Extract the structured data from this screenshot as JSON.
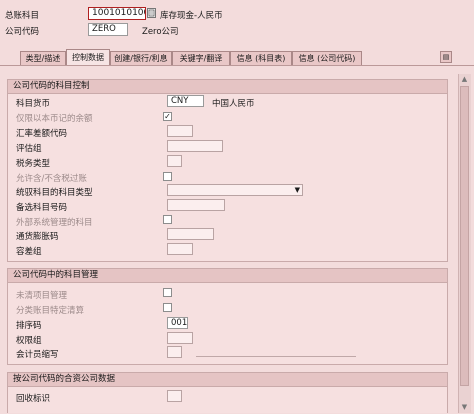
{
  "header": {
    "gl_account_label": "总账科目",
    "gl_account_value": "1001010100",
    "gl_account_desc": "库存现金-人民币",
    "company_code_label": "公司代码",
    "company_code_value": "ZERO",
    "company_code_desc": "Zero公司"
  },
  "tabs": [
    {
      "label": "类型/描述"
    },
    {
      "label": "控制数据"
    },
    {
      "label": "创建/银行/利息"
    },
    {
      "label": "关键字/翻译"
    },
    {
      "label": "信息 (科目表)"
    },
    {
      "label": "信息 (公司代码)"
    }
  ],
  "group1": {
    "title": "公司代码的科目控制",
    "currency_label": "科目货币",
    "currency_value": "CNY",
    "currency_desc": "中国人民币",
    "local_balances_label": "仅限以本币记的余额",
    "local_balances_checked": "✓",
    "exch_diff_label": "汇率差额代码",
    "valuation_label": "评估组",
    "tax_category_label": "税务类型",
    "post_without_tax_label": "允许含/不含税过账",
    "recon_account_label": "统驭科目的科目类型",
    "alt_account_label": "备选科目号码",
    "external_mgmt_label": "外部系统管理的科目",
    "inflation_key_label": "通货膨胀码",
    "tolerance_group_label": "容差组"
  },
  "group2": {
    "title": "公司代码中的科目管理",
    "open_item_label": "未清项目管理",
    "line_item_label": "分类账目特定清算",
    "sort_key_label": "排序码",
    "sort_key_value": "001",
    "authorization_label": "权限组",
    "accounting_clerk_label": "会计员缩写"
  },
  "group3": {
    "title": "按公司代码的合资公司数据",
    "recovery_label": "回收标识"
  }
}
